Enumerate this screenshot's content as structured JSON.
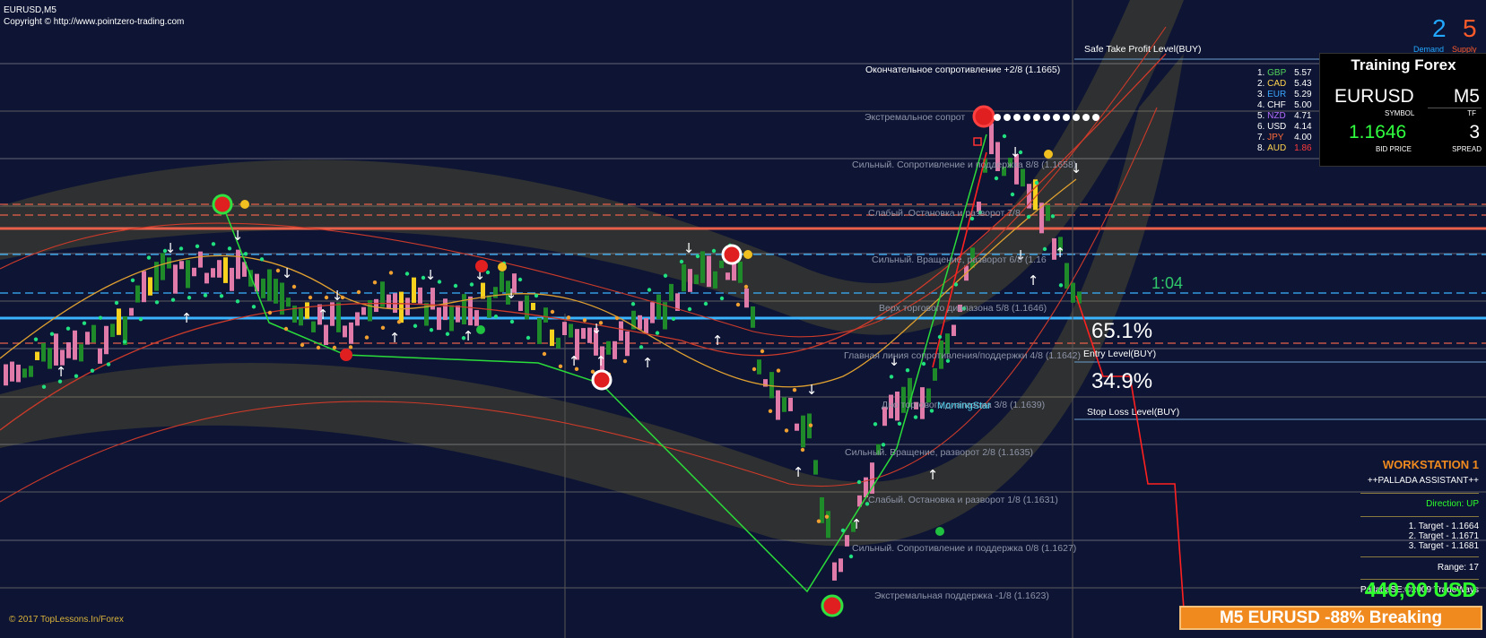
{
  "header": {
    "symbol": "EURUSD,M5",
    "copyright": "Copyright © http://www.pointzero-trading.com"
  },
  "levels": [
    {
      "label": "Safe Take Profit Level(BUY)"
    },
    {
      "label": "Окончательное сопротивление +2/8  (1.1665)"
    },
    {
      "label": "Экстремальное сопрот"
    },
    {
      "label": "Сильный. Сопротивление и поддержка 8/8  (1.1658)"
    },
    {
      "label": "Слабый. Остановка и разворот 7/8"
    },
    {
      "label": "Сильный. Вращение, разворот 6/8  (1.16"
    },
    {
      "label": "Верх торгового диапазона 5/8  (1.1646)"
    },
    {
      "label": "Главная линия сопротивления/поддержки 4/8  (1.1642)"
    },
    {
      "label": "Дно торгового диапазона 3/8  (1.1639)"
    },
    {
      "label": "Сильный. Вращение, разворот 2/8  (1.1635)"
    },
    {
      "label": "Слабый. Остановка и разворот 1/8  (1.1631)"
    },
    {
      "label": "Сильный. Сопротивление и поддержка 0/8  (1.1627)"
    },
    {
      "label": "Экстремальная поддержка -1/8  (1.1623)"
    }
  ],
  "entry": {
    "percent_up": "65.1%",
    "entry_label": "Entry Level(BUY)",
    "percent_down": "34.9%",
    "stop_label": "Stop Loss Level(BUY)"
  },
  "pattern_label": "MorningStar",
  "timer": "1:04",
  "demand_supply": {
    "demand_value": "2",
    "demand_label": "Demand",
    "supply_value": "5",
    "supply_label": "Supply",
    "demand_color": "#22a8ff",
    "supply_color": "#ff5a2a"
  },
  "currency_strength": [
    {
      "rank": "1.",
      "code": "GBP",
      "value": "5.57",
      "color": "#52d35b"
    },
    {
      "rank": "2.",
      "code": "CAD",
      "value": "5.43",
      "color": "#ffd34d"
    },
    {
      "rank": "3.",
      "code": "EUR",
      "value": "5.29",
      "color": "#3aa6ff"
    },
    {
      "rank": "4.",
      "code": "CHF",
      "value": "5.00",
      "color": "#ffffff"
    },
    {
      "rank": "5.",
      "code": "NZD",
      "value": "4.71",
      "color": "#b36cff"
    },
    {
      "rank": "6.",
      "code": "USD",
      "value": "4.14",
      "color": "#ffffff"
    },
    {
      "rank": "7.",
      "code": "JPY",
      "value": "4.00",
      "color": "#ff6a3a"
    },
    {
      "rank": "8.",
      "code": "AUD",
      "value": "1.86",
      "color": "#ffd34d",
      "value_color": "#ff3a3a"
    }
  ],
  "info_panel": {
    "title": "Training Forex",
    "symbol": "EURUSD",
    "symbol_label": "SYMBOL",
    "tf": "M5",
    "tf_label": "TF",
    "bid": "1.1646",
    "bid_label": "BID PRICE",
    "spread": "3",
    "spread_label": "SPREAD"
  },
  "workstation": {
    "title": "WORKSTATION 1",
    "subtitle": "++PALLADA ASSISTANT++",
    "direction": "Direction: UP",
    "target1": "1. Target - 1.1664",
    "target2": "2. Target - 1.1671",
    "target3": "3. Target - 1.1681",
    "range": "Range: 17",
    "credit": "PalladaSE.©2009 TradeWays"
  },
  "profit": "440,00 USD",
  "breaking": "M5 EURUSD  -88% Breaking",
  "footer_copy": "© 2017 TopLessons.In/Forex"
}
